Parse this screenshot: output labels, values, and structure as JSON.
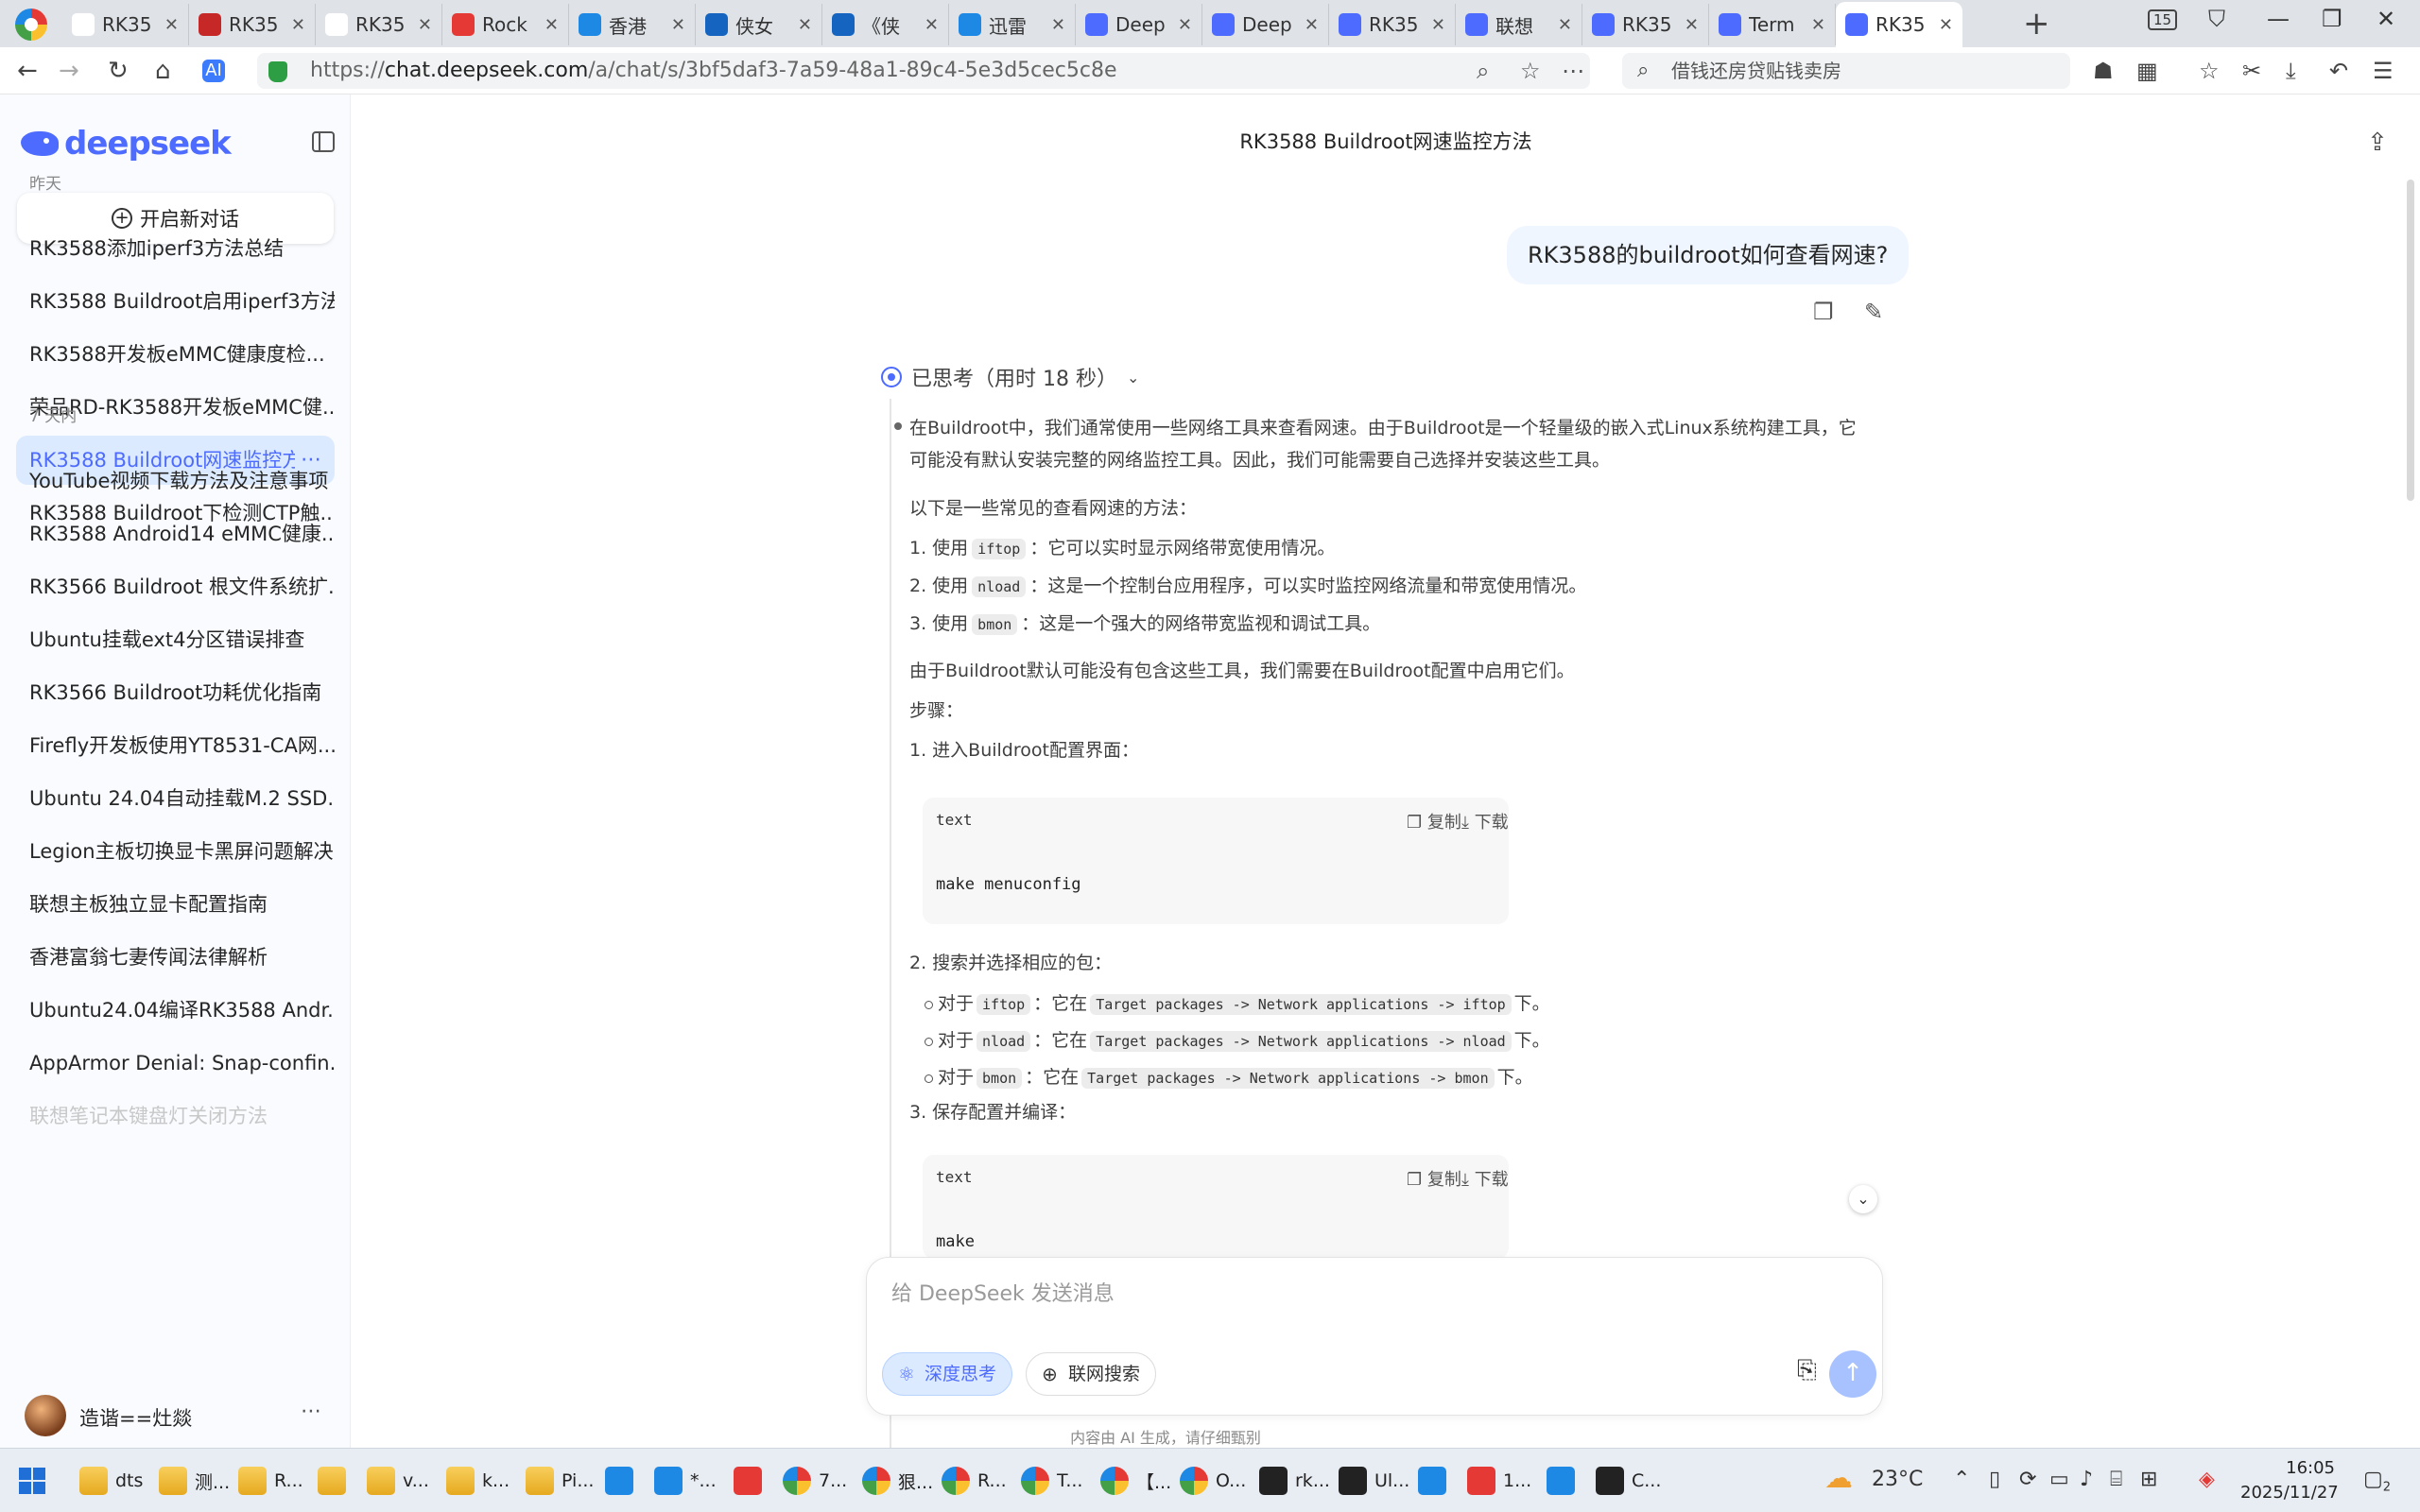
{
  "browser": {
    "tabs": [
      {
        "label": "RK35",
        "color": "#ffffff"
      },
      {
        "label": "RK35",
        "color": "#c62828"
      },
      {
        "label": "RK35",
        "color": "#ffffff"
      },
      {
        "label": "Rock",
        "color": "#e53935"
      },
      {
        "label": "香港",
        "color": "#1e88e5"
      },
      {
        "label": "侠女",
        "color": "#1565c0"
      },
      {
        "label": "《侠",
        "color": "#1565c0"
      },
      {
        "label": "迅雷",
        "color": "#1e88e5"
      },
      {
        "label": "Deep",
        "color": "#4d6bfe"
      },
      {
        "label": "Deep",
        "color": "#4d6bfe"
      },
      {
        "label": "RK35",
        "color": "#4d6bfe"
      },
      {
        "label": "联想",
        "color": "#4d6bfe"
      },
      {
        "label": "RK35",
        "color": "#4d6bfe"
      },
      {
        "label": "Term",
        "color": "#4d6bfe"
      },
      {
        "label": "RK35",
        "color": "#4d6bfe"
      }
    ],
    "active_tab_index": 14,
    "tab_count": "15",
    "url_domain": "chat.deepseek.com",
    "url_prefix": "https://",
    "url_path": "/a/chat/s/3bf5daf3-7a59-48a1-89c4-5e3d5cec5c8e",
    "search_text": "借钱还房贷贴钱卖房"
  },
  "sidebar": {
    "logo": "deepseek",
    "new_chat": "开启新对话",
    "groups": [
      {
        "label": "昨天",
        "items": [
          "RK3588添加iperf3方法总结",
          "RK3588 Buildroot启用iperf3方法",
          "RK3588开发板eMMC健康度检...",
          "荣品RD-RK3588开发板eMMC健...",
          "RK3588 Buildroot网速监控方法",
          "RK3588 Buildroot下检测CTP触..."
        ]
      },
      {
        "label": "7 天内",
        "items": [
          "YouTube视频下载方法及注意事项",
          "RK3588 Android14 eMMC健康...",
          "RK3566 Buildroot 根文件系统扩...",
          "Ubuntu挂载ext4分区错误排查",
          "RK3566 Buildroot功耗优化指南",
          "Firefly开发板使用YT8531-CA网...",
          "Ubuntu 24.04自动挂载M.2 SSD...",
          "Legion主板切换显卡黑屏问题解决",
          "联想主板独立显卡配置指南",
          "香港富翁七妻传闻法律解析",
          "Ubuntu24.04编译RK3588 Andr...",
          "AppArmor Denial: Snap-confin...",
          "联想笔记本键盘灯关闭方法"
        ]
      }
    ],
    "active_item": "RK3588 Buildroot网速监控方法",
    "user": "造谐==灶燚"
  },
  "chat": {
    "title": "RK3588 Buildroot网速监控方法",
    "user_message": "RK3588的buildroot如何查看网速?",
    "think_label": "已思考（用时 18 秒）",
    "intro_1": "在Buildroot中，我们通常使用一些网络工具来查看网速。由于Buildroot是一个轻量级的嵌入式Linux系统构建工具，它",
    "intro_2": "可能没有默认安装完整的网络监控工具。因此，我们可能需要自己选择并安装这些工具。",
    "methods_heading": "以下是一些常见的查看网速的方法：",
    "methods": [
      {
        "num": "1. 使用",
        "code": "iftop",
        "desc": "：它可以实时显示网络带宽使用情况。"
      },
      {
        "num": "2. 使用",
        "code": "nload",
        "desc": "：这是一个控制台应用程序，可以实时监控网络流量和带宽使用情况。"
      },
      {
        "num": "3. 使用",
        "code": "bmon",
        "desc": "：这是一个强大的网络带宽监视和调试工具。"
      }
    ],
    "note": "由于Buildroot默认可能没有包含这些工具，我们需要在Buildroot配置中启用它们。",
    "steps_heading": "步骤：",
    "step1": "1. 进入Buildroot配置界面：",
    "code1_lang": "text",
    "code1_body": "make menuconfig",
    "copy_label": "复制",
    "download_label": "下载",
    "step2": "2. 搜索并选择相应的包：",
    "packages": [
      {
        "pre": "对于",
        "code": "iftop",
        "mid": "：它在",
        "path": "Target packages -> Network applications -> iftop",
        "post": "下。"
      },
      {
        "pre": "对于",
        "code": "nload",
        "mid": "：它在",
        "path": "Target packages -> Network applications -> nload",
        "post": "下。"
      },
      {
        "pre": "对于",
        "code": "bmon",
        "mid": "：它在",
        "path": "Target packages -> Network applications -> bmon",
        "post": "下。"
      }
    ],
    "step3": "3. 保存配置并编译：",
    "code2_lang": "text",
    "code2_body": "make"
  },
  "composer": {
    "placeholder": "给 DeepSeek 发送消息",
    "deep_think": "深度思考",
    "web_search": "联网搜索",
    "disclaimer": "内容由 AI 生成，请仔细甄别"
  },
  "taskbar": {
    "items": [
      "dts",
      "测...",
      "R...",
      "",
      "v...",
      "k...",
      "Pi...",
      "",
      "*...",
      "",
      "7...",
      "狠...",
      "R...",
      "T...",
      "【...",
      "O...",
      "rk...",
      "Ul...",
      "",
      "1...",
      "",
      "C..."
    ],
    "weather": "23°C",
    "time": "16:05",
    "date": "2025/11/27",
    "notifications": "2"
  },
  "colors": {
    "accent": "#4d6bfe",
    "active_item_bg": "#dbeafe",
    "user_bubble": "#eff6ff"
  }
}
